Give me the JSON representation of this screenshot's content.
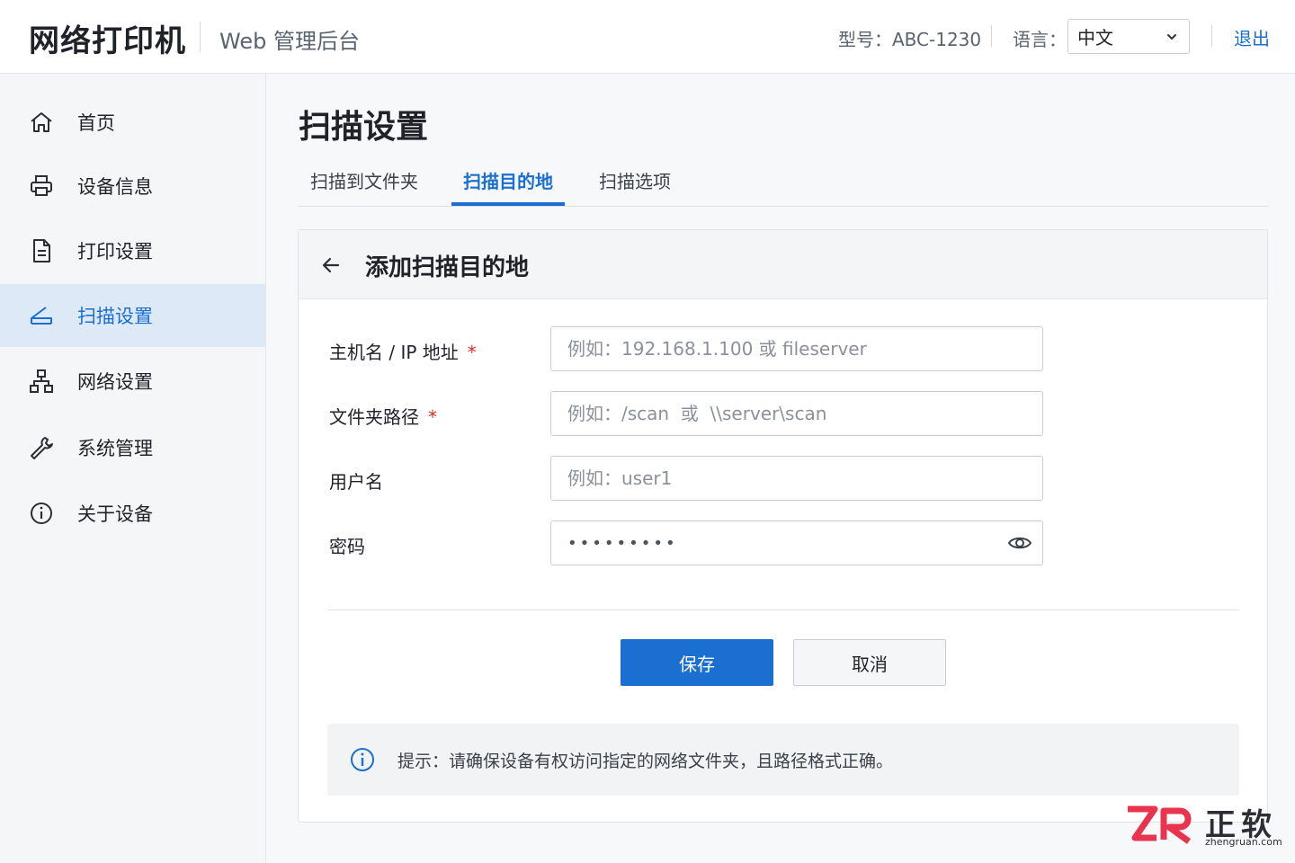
{
  "header": {
    "brand": "网络打印机",
    "subtitle": "Web 管理后台",
    "model": "型号：ABC-1230",
    "language_label": "语言：",
    "language_value": "中文",
    "logout": "退出"
  },
  "sidebar": {
    "items": [
      {
        "label": "首页",
        "icon": "home-icon",
        "active": false
      },
      {
        "label": "设备信息",
        "icon": "printer-icon",
        "active": false
      },
      {
        "label": "打印设置",
        "icon": "document-icon",
        "active": false
      },
      {
        "label": "扫描设置",
        "icon": "scanner-icon",
        "active": true
      },
      {
        "label": "网络设置",
        "icon": "network-icon",
        "active": false
      },
      {
        "label": "系统管理",
        "icon": "wrench-icon",
        "active": false
      },
      {
        "label": "关于设备",
        "icon": "info-icon",
        "active": false
      }
    ]
  },
  "main": {
    "title": "扫描设置",
    "tabs": [
      {
        "label": "扫描到文件夹",
        "active": false
      },
      {
        "label": "扫描目的地",
        "active": true
      },
      {
        "label": "扫描选项",
        "active": false
      }
    ],
    "card": {
      "title": "添加扫描目的地",
      "fields": [
        {
          "label": "主机名 / IP 地址",
          "required": true,
          "placeholder": "例如：192.168.1.100 或 fileserver"
        },
        {
          "label": "文件夹路径",
          "required": true,
          "placeholder": "例如：/scan  或  \\\\server\\scan"
        },
        {
          "label": "用户名",
          "required": false,
          "placeholder": "例如：user1"
        },
        {
          "label": "密码",
          "required": false,
          "value": "•••••••••"
        }
      ],
      "required_mark": "*",
      "save_label": "保存",
      "cancel_label": "取消",
      "tip": "提示：请确保设备有权访问指定的网络文件夹，且路径格式正确。"
    }
  },
  "watermark": {
    "cn": "正软",
    "en": "zhengruan.com"
  },
  "colors": {
    "accent": "#1a6fd1",
    "active_nav_bg": "#dde9f7",
    "required": "#d93025",
    "watermark_red": "#e8344e"
  }
}
